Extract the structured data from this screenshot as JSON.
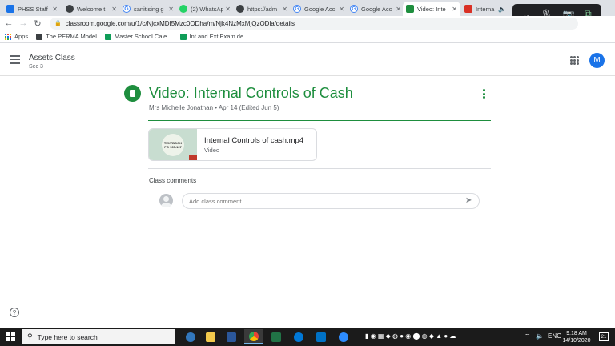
{
  "browser": {
    "tabs": [
      {
        "title": "PHSS Staff",
        "favicon": "#1a73e8"
      },
      {
        "title": "Welcome t",
        "favicon": "#3c4043"
      },
      {
        "title": "sanitising g",
        "favicon": "#4285f4"
      },
      {
        "title": "(2) WhatsAp",
        "favicon": "#25d366"
      },
      {
        "title": "https://adm",
        "favicon": "#3c4043"
      },
      {
        "title": "Google Acc",
        "favicon": "#4285f4"
      },
      {
        "title": "Google Acc",
        "favicon": "#4285f4"
      },
      {
        "title": "Video: Inte",
        "favicon": "#1e8e3e"
      },
      {
        "title": "Interna",
        "favicon": "#d93025"
      }
    ],
    "tab_close": "✕",
    "url": "classroom.google.com/u/1/c/NjcxMDI5Mzc0ODha/m/Njk4NzMxMjQzODla/details",
    "bookmarks": [
      {
        "label": "Apps",
        "color": "#5f6368"
      },
      {
        "label": "The PERMA Model",
        "color": "#3c4043"
      },
      {
        "label": "Master School Cale...",
        "color": "#0f9d58"
      },
      {
        "label": "Int and Ext Exam de...",
        "color": "#0f9d58"
      }
    ]
  },
  "classroom": {
    "class_name": "Assets Class",
    "section": "Sec 3",
    "avatar_initial": "M",
    "post_title": "Video: Internal Controls of Cash",
    "post_meta": "Mrs Michelle Jonathan • Apr 14 (Edited Jun 5)",
    "attachment": {
      "name": "Internal Controls of cash.mp4",
      "type": "Video",
      "thumb_text": "TEXTBOOK PG 105-107"
    },
    "comments_label": "Class comments",
    "comment_placeholder": "Add class comment..."
  },
  "taskbar": {
    "search_placeholder": "Type here to search",
    "time": "9:18 AM",
    "date": "14/10/2020",
    "language": "ENG",
    "notification_count": "21"
  },
  "colors": {
    "accent": "#1e8e3e",
    "avatar": "#1a73e8"
  }
}
